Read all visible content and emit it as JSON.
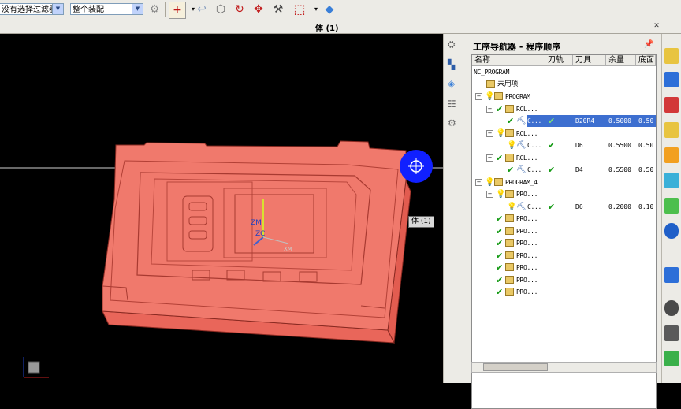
{
  "toolbar": {
    "selection_filter": "没有选择过滤器",
    "assembly_scope": "整个装配"
  },
  "window": {
    "title": "体 (1)"
  },
  "viewport": {
    "tooltip": "体 (1)",
    "axis_labels": {
      "zm": "ZM",
      "zc": "ZC",
      "xm": "XM"
    }
  },
  "navigator": {
    "title": "工序导航器 - 程序顺序",
    "columns": [
      "名称",
      "刀轨",
      "刀具",
      "余量",
      "底面"
    ],
    "rows": [
      {
        "name": "NC_PROGRAM",
        "path": "",
        "tool": "",
        "stock": "",
        "floor": ""
      },
      {
        "name": "未用项",
        "path": "",
        "tool": "",
        "stock": "",
        "floor": ""
      },
      {
        "name": "PROGRAM",
        "path": "",
        "tool": "",
        "stock": "",
        "floor": ""
      },
      {
        "name": "RCL...",
        "path": "",
        "tool": "",
        "stock": "",
        "floor": ""
      },
      {
        "name": "C...",
        "path": "✔",
        "tool": "D20R4",
        "stock": "0.5000",
        "floor": "0.50"
      },
      {
        "name": "RCL...",
        "path": "",
        "tool": "",
        "stock": "",
        "floor": ""
      },
      {
        "name": "C...",
        "path": "✔",
        "tool": "D6",
        "stock": "0.5500",
        "floor": "0.50"
      },
      {
        "name": "RCL...",
        "path": "",
        "tool": "",
        "stock": "",
        "floor": ""
      },
      {
        "name": "C...",
        "path": "✔",
        "tool": "D4",
        "stock": "0.5500",
        "floor": "0.50"
      },
      {
        "name": "PROGRAM_4",
        "path": "",
        "tool": "",
        "stock": "",
        "floor": ""
      },
      {
        "name": "PRO...",
        "path": "",
        "tool": "",
        "stock": "",
        "floor": ""
      },
      {
        "name": "C...",
        "path": "✔",
        "tool": "D6",
        "stock": "0.2000",
        "floor": "0.10"
      },
      {
        "name": "PRO...",
        "path": "",
        "tool": "",
        "stock": "",
        "floor": ""
      },
      {
        "name": "PRO...",
        "path": "",
        "tool": "",
        "stock": "",
        "floor": ""
      },
      {
        "name": "PRO...",
        "path": "",
        "tool": "",
        "stock": "",
        "floor": ""
      },
      {
        "name": "PRO...",
        "path": "",
        "tool": "",
        "stock": "",
        "floor": ""
      },
      {
        "name": "PRO...",
        "path": "",
        "tool": "",
        "stock": "",
        "floor": ""
      },
      {
        "name": "PRO...",
        "path": "",
        "tool": "",
        "stock": "",
        "floor": ""
      },
      {
        "name": "PRO...",
        "path": "",
        "tool": "",
        "stock": "",
        "floor": ""
      }
    ]
  },
  "colors": {
    "part_fill": "#f0796c",
    "part_edge": "#8a2a22",
    "selection": "#3d6fd0",
    "check": "#149a14",
    "cursor_disc": "#1020ff"
  }
}
